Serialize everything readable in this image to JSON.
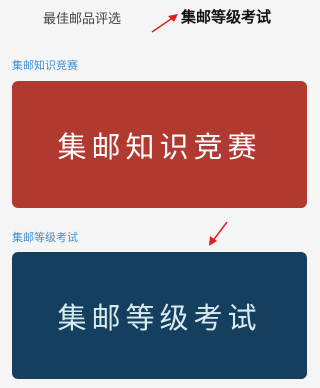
{
  "tabs": [
    {
      "label": "最佳邮品评选",
      "active": false
    },
    {
      "label": "集邮等级考试",
      "active": true
    }
  ],
  "sections": [
    {
      "title": "集邮知识竞赛",
      "banner_text": "集邮知识竞赛",
      "color": "#b03a30"
    },
    {
      "title": "集邮等级考试",
      "banner_text": "集邮等级考试",
      "color": "#153f5f"
    }
  ],
  "annotation_color": "#e02020"
}
